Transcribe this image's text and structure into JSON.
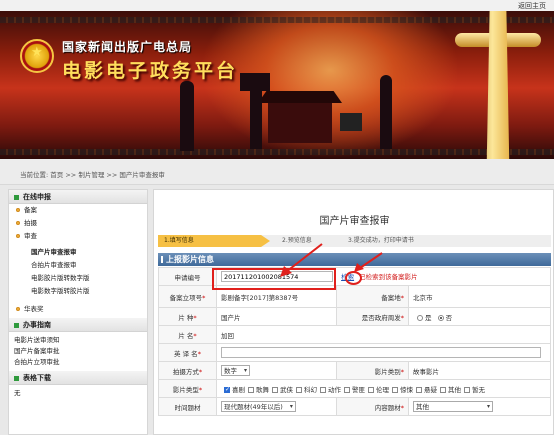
{
  "topbar": {
    "home_link": "返回主页"
  },
  "banner": {
    "org_title": "国家新闻出版广电总局",
    "platform_title": "电影电子政务平台"
  },
  "breadcrumb": {
    "label": "当前位置:",
    "items": [
      "首页",
      "制片管理",
      "国产片审查报审"
    ],
    "sep": " >> "
  },
  "sidebar": {
    "section1": {
      "title": "在线申报",
      "items": [
        {
          "label": "备案"
        },
        {
          "label": "拍摄"
        },
        {
          "label": "审查"
        }
      ],
      "subitems": [
        "国产片审查报审",
        "合拍片审查报审",
        "电影胶片版转数字版",
        "电影数字版转胶片版"
      ],
      "extra": {
        "label": "华表奖"
      }
    },
    "section2": {
      "title": "办事指南",
      "links": [
        "电影片送审须知",
        "国产片备案审批",
        "合拍片立项审批"
      ]
    },
    "section3": {
      "title": "表格下载",
      "links": [
        "无"
      ]
    }
  },
  "content": {
    "title": "国产片审查报审",
    "steps": [
      "1.填写信息",
      "2.预览信息",
      "3.提交成功，打印申请书"
    ],
    "section_title": "上报影片信息",
    "form": {
      "apply_no_label": "申请编号",
      "apply_no_value": "201711201002081574",
      "check_button": "检索",
      "check_warning": "已检索到该备案影片",
      "filing_no_label": "备案立项号",
      "filing_no_value": "影剧备字[2017]第8387号",
      "filing_place_label": "备案地",
      "filing_place_value": "北京市",
      "type_label": "片 种",
      "type_value": "国产片",
      "cofund_label": "是否政府周发",
      "yes_label": "是",
      "no_label": "否",
      "name_label": "片 名",
      "name_value": "加回",
      "en_name_label": "英 译 名",
      "en_name_value": "",
      "shoot_label": "拍摄方式",
      "shoot_value": "数字",
      "category_label": "影片类别",
      "category_value": "故事影片",
      "genre_label": "影片类型",
      "genres": [
        {
          "label": "喜剧",
          "checked": true
        },
        {
          "label": "歌舞",
          "checked": false
        },
        {
          "label": "武侠",
          "checked": false
        },
        {
          "label": "科幻",
          "checked": false
        },
        {
          "label": "动作",
          "checked": false
        },
        {
          "label": "警匪",
          "checked": false
        },
        {
          "label": "伦理",
          "checked": false
        },
        {
          "label": "惊悚",
          "checked": false
        },
        {
          "label": "悬疑",
          "checked": false
        },
        {
          "label": "其他",
          "checked": false
        },
        {
          "label": "暂无",
          "checked": false
        }
      ],
      "era_label": "时间题材",
      "era_value": "现代题材(49年以后)",
      "content_label": "内容题材",
      "content_value": "其他"
    }
  },
  "colors": {
    "accent_red": "#e0201c",
    "header_blue": "#3f6a9a",
    "step_active": "#f6c044"
  }
}
